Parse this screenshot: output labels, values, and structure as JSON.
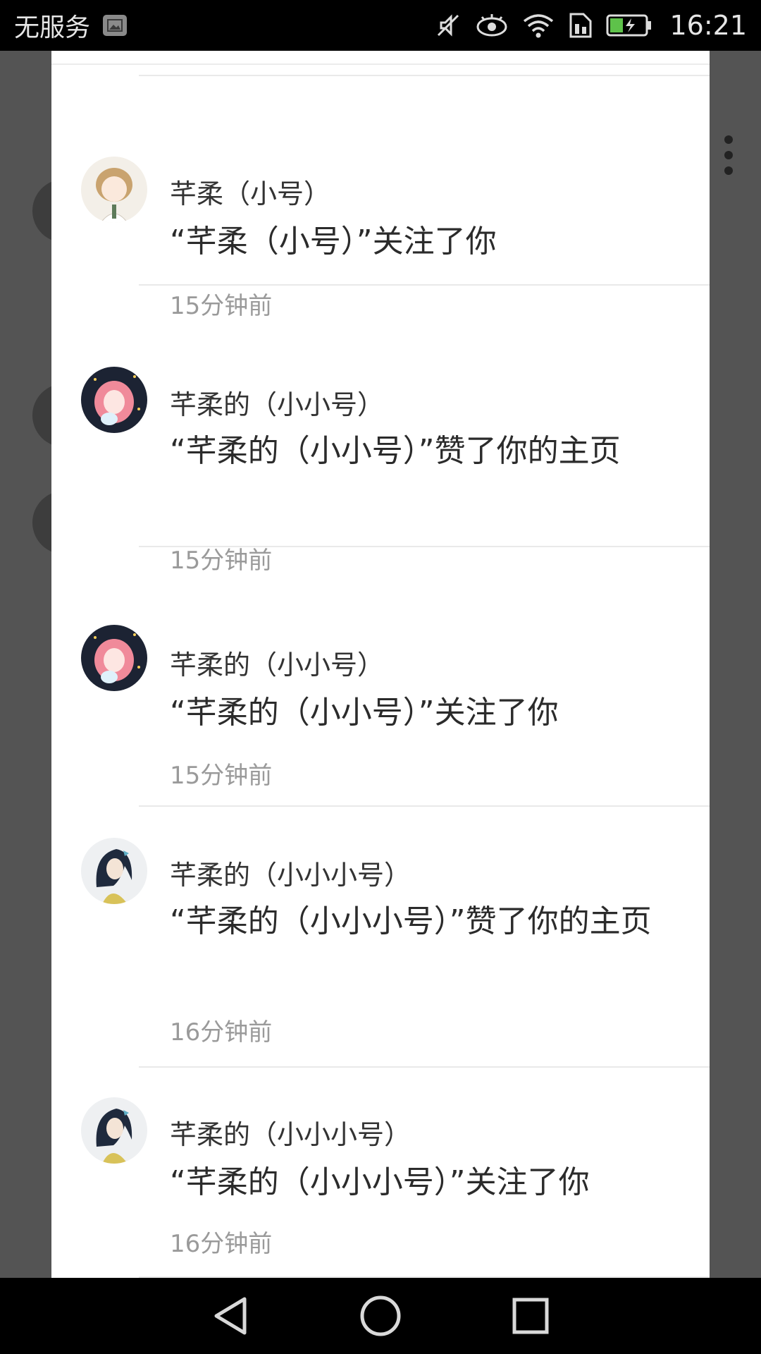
{
  "status_bar": {
    "carrier": "无服务",
    "time": "16:21",
    "icons": [
      "image-notification-icon",
      "mute-icon",
      "eye-icon",
      "wifi-icon",
      "sim-icon",
      "battery-charging-icon"
    ]
  },
  "notifications": [
    {
      "name": "芊柔（小号）",
      "message": "“芊柔（小号）”关注了你",
      "time": "15分钟前",
      "avatar": "avatar-girl-tan",
      "accent": "#c9a36f"
    },
    {
      "name": "芊柔的（小小号）",
      "message": "“芊柔的（小小号）”赞了你的主页",
      "time": "15分钟前",
      "avatar": "avatar-girl-pink-hair",
      "accent": "#f08a9a"
    },
    {
      "name": "芊柔的（小小号）",
      "message": "“芊柔的（小小号）”关注了你",
      "time": "15分钟前",
      "avatar": "avatar-girl-pink-hair",
      "accent": "#f08a9a"
    },
    {
      "name": "芊柔的（小小小号）",
      "message": "“芊柔的（小小小号）”赞了你的主页",
      "time": "16分钟前",
      "avatar": "avatar-boy-dark-hair",
      "accent": "#d8c259"
    },
    {
      "name": "芊柔的（小小小号）",
      "message": "“芊柔的（小小小号）”关注了你",
      "time": "16分钟前",
      "avatar": "avatar-boy-dark-hair",
      "accent": "#d8c259"
    }
  ],
  "nav_bar": {
    "buttons": [
      "back-icon",
      "home-icon",
      "recents-icon"
    ]
  }
}
